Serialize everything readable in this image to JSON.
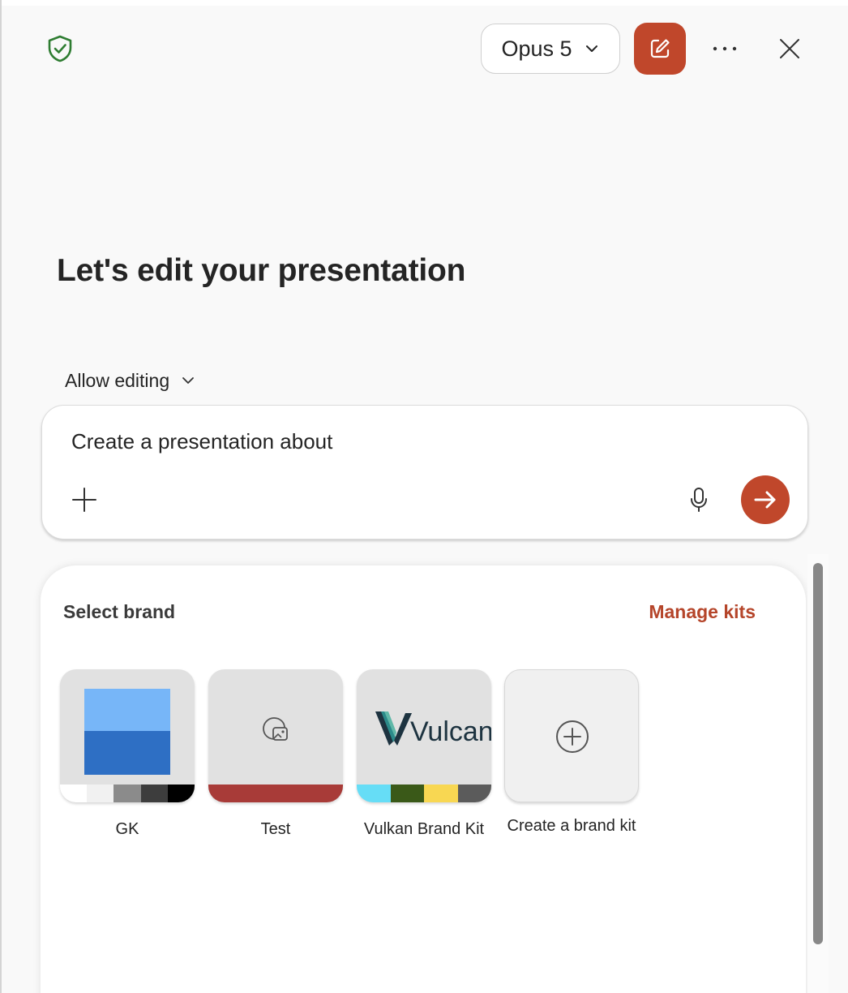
{
  "header": {
    "model_label": "Opus 5",
    "shield_icon": "shield-check-icon",
    "new_chat_icon": "compose-icon",
    "more_icon": "more-horizontal-icon",
    "close_icon": "close-icon"
  },
  "main": {
    "title": "Let's edit your presentation",
    "mode_label": "Allow editing"
  },
  "composer": {
    "input_value": "Create a presentation about",
    "attach_icon": "plus-icon",
    "mic_icon": "microphone-icon",
    "send_icon": "arrow-right-icon"
  },
  "brand": {
    "heading": "Select brand",
    "manage_label": "Manage kits",
    "kits": [
      {
        "name": "GK",
        "colors": [
          "#ffffff",
          "#f1f1f1",
          "#8b8b8b",
          "#3d3d3d",
          "#000000"
        ],
        "logo_colors": [
          "#77b6f8",
          "#2e6fc4"
        ]
      },
      {
        "name": "Test",
        "colors": [
          "#a83b38"
        ],
        "icon": "image-placeholder-icon"
      },
      {
        "name": "Vulkan Brand Kit",
        "logo_text": "Vulcan",
        "colors": [
          "#66ddf6",
          "#3a5918",
          "#f8d752",
          "#5b5b5b"
        ]
      },
      {
        "name": "Create a brand kit",
        "icon": "add-circle-icon"
      }
    ]
  },
  "colors": {
    "accent": "#c0472b",
    "link": "#b5452a",
    "shield": "#2f7d32"
  }
}
